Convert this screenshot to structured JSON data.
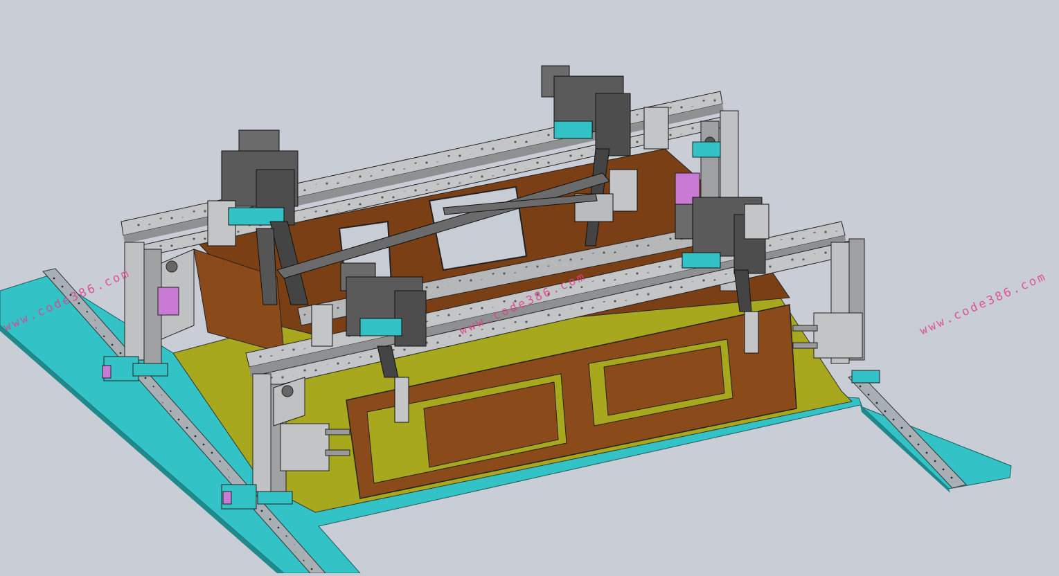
{
  "scene": {
    "subject": "cad-assembly-fixture",
    "colors": {
      "background": "#c9cdd6",
      "base_plate": "#33c3c6",
      "rail": "#a9b0b5",
      "frame": "#bfc1c2",
      "panel_brown": "#8a4a1a",
      "panel_yellow": "#a8a81e",
      "mechanism": "#6b6b6b",
      "accent_pink": "#c97ad4"
    }
  },
  "watermarks": [
    {
      "text": "www.code386.com"
    },
    {
      "text": "www.code386.com"
    },
    {
      "text": "www.code386.com"
    }
  ]
}
